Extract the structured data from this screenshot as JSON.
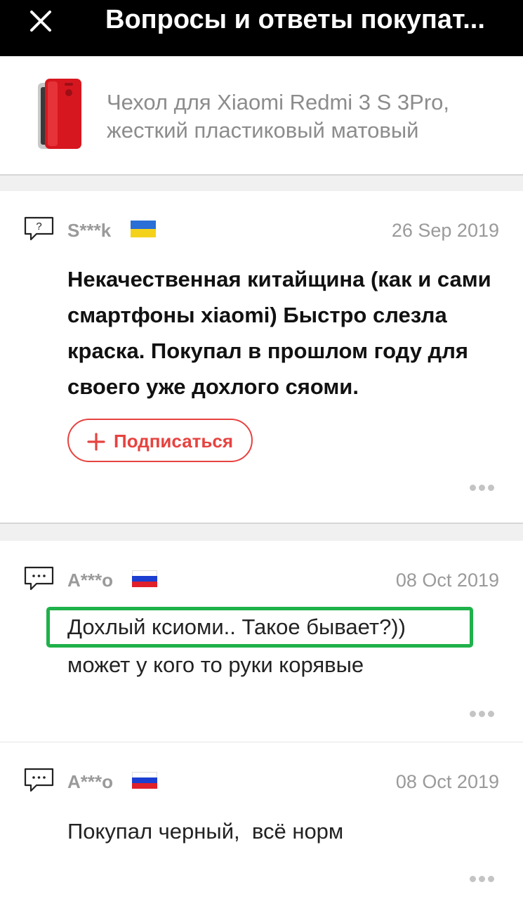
{
  "header": {
    "title": "Вопросы и ответы покупат..."
  },
  "product": {
    "name": "Чехол для Xiaomi Redmi 3 S 3Pro, жесткий пластиковый матовый"
  },
  "question": {
    "author": "S***k",
    "country": "Ukraine",
    "date": "26 Sep 2019",
    "text": "Некачественная китайщина (как и сами смартфоны xiaomi) Быстро слезла краска. Покупал в прошлом году для своего уже дохлого сяоми.",
    "subscribe_label": "Подписаться"
  },
  "answers": [
    {
      "author": "A***o",
      "country": "Russia",
      "date": "08 Oct 2019",
      "text": "Дохлый ксиоми.. Такое бывает?)) может у кого то руки корявые",
      "highlighted_text": "Дохлый ксиоми.. Такое бывает?))"
    },
    {
      "author": "A***o",
      "country": "Russia",
      "date": "08 Oct 2019",
      "text": "Покупал черный,  всё норм"
    }
  ],
  "colors": {
    "header_bg": "#000000",
    "accent_red": "#e64340",
    "highlight_green": "#1fb14a",
    "meta_gray": "#9a9a9a"
  }
}
